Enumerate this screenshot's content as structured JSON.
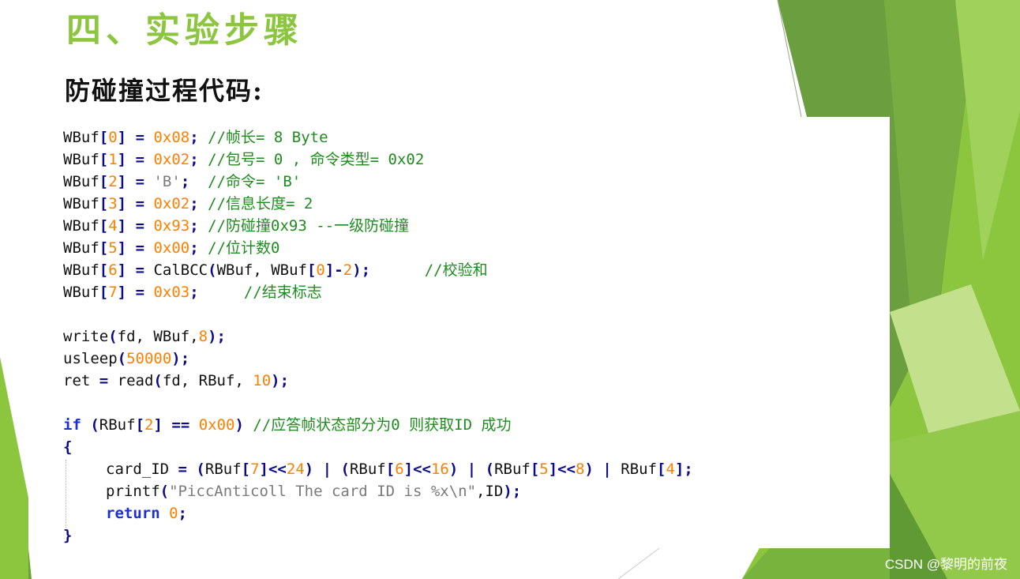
{
  "slide": {
    "title": "四、实验步骤",
    "subtitle": "防碰撞过程代码:",
    "watermark": "CSDN @黎明的前夜"
  },
  "theme": {
    "accent_green": "#8cc63e",
    "dark_green": "#5d9a36",
    "comment_green": "#1e8c1e",
    "number_orange": "#ff8000",
    "keyword_blue": "#1a2fd6",
    "operator_navy": "#0b0b8a"
  },
  "code": {
    "lines": [
      {
        "tokens": [
          {
            "t": "WBuf",
            "k": "id"
          },
          {
            "t": "[",
            "k": "op"
          },
          {
            "t": "0",
            "k": "num"
          },
          {
            "t": "]",
            "k": "op"
          },
          {
            "t": " ",
            "k": "id"
          },
          {
            "t": "=",
            "k": "op"
          },
          {
            "t": " ",
            "k": "id"
          },
          {
            "t": "0x08",
            "k": "num"
          },
          {
            "t": "; ",
            "k": "op"
          },
          {
            "t": "//帧长= 8 Byte",
            "k": "cm"
          }
        ]
      },
      {
        "tokens": [
          {
            "t": "WBuf",
            "k": "id"
          },
          {
            "t": "[",
            "k": "op"
          },
          {
            "t": "1",
            "k": "num"
          },
          {
            "t": "]",
            "k": "op"
          },
          {
            "t": " ",
            "k": "id"
          },
          {
            "t": "=",
            "k": "op"
          },
          {
            "t": " ",
            "k": "id"
          },
          {
            "t": "0x02",
            "k": "num"
          },
          {
            "t": "; ",
            "k": "op"
          },
          {
            "t": "//包号= 0 , 命令类型= 0x02",
            "k": "cm"
          }
        ]
      },
      {
        "tokens": [
          {
            "t": "WBuf",
            "k": "id"
          },
          {
            "t": "[",
            "k": "op"
          },
          {
            "t": "2",
            "k": "num"
          },
          {
            "t": "]",
            "k": "op"
          },
          {
            "t": " ",
            "k": "id"
          },
          {
            "t": "=",
            "k": "op"
          },
          {
            "t": " ",
            "k": "id"
          },
          {
            "t": "'B'",
            "k": "str"
          },
          {
            "t": ";  ",
            "k": "op"
          },
          {
            "t": "//命令= 'B'",
            "k": "cm"
          }
        ]
      },
      {
        "tokens": [
          {
            "t": "WBuf",
            "k": "id"
          },
          {
            "t": "[",
            "k": "op"
          },
          {
            "t": "3",
            "k": "num"
          },
          {
            "t": "]",
            "k": "op"
          },
          {
            "t": " ",
            "k": "id"
          },
          {
            "t": "=",
            "k": "op"
          },
          {
            "t": " ",
            "k": "id"
          },
          {
            "t": "0x02",
            "k": "num"
          },
          {
            "t": "; ",
            "k": "op"
          },
          {
            "t": "//信息长度= 2",
            "k": "cm"
          }
        ]
      },
      {
        "tokens": [
          {
            "t": "WBuf",
            "k": "id"
          },
          {
            "t": "[",
            "k": "op"
          },
          {
            "t": "4",
            "k": "num"
          },
          {
            "t": "]",
            "k": "op"
          },
          {
            "t": " ",
            "k": "id"
          },
          {
            "t": "=",
            "k": "op"
          },
          {
            "t": " ",
            "k": "id"
          },
          {
            "t": "0x93",
            "k": "num"
          },
          {
            "t": "; ",
            "k": "op"
          },
          {
            "t": "//防碰撞0x93 --一级防碰撞",
            "k": "cm"
          }
        ]
      },
      {
        "tokens": [
          {
            "t": "WBuf",
            "k": "id"
          },
          {
            "t": "[",
            "k": "op"
          },
          {
            "t": "5",
            "k": "num"
          },
          {
            "t": "]",
            "k": "op"
          },
          {
            "t": " ",
            "k": "id"
          },
          {
            "t": "=",
            "k": "op"
          },
          {
            "t": " ",
            "k": "id"
          },
          {
            "t": "0x00",
            "k": "num"
          },
          {
            "t": "; ",
            "k": "op"
          },
          {
            "t": "//位计数0",
            "k": "cm"
          }
        ]
      },
      {
        "tokens": [
          {
            "t": "WBuf",
            "k": "id"
          },
          {
            "t": "[",
            "k": "op"
          },
          {
            "t": "6",
            "k": "num"
          },
          {
            "t": "]",
            "k": "op"
          },
          {
            "t": " ",
            "k": "id"
          },
          {
            "t": "=",
            "k": "op"
          },
          {
            "t": " CalBCC",
            "k": "id"
          },
          {
            "t": "(",
            "k": "op"
          },
          {
            "t": "WBuf, WBuf",
            "k": "id"
          },
          {
            "t": "[",
            "k": "op"
          },
          {
            "t": "0",
            "k": "num"
          },
          {
            "t": "]-",
            "k": "op"
          },
          {
            "t": "2",
            "k": "num"
          },
          {
            "t": ");      ",
            "k": "op"
          },
          {
            "t": "//校验和",
            "k": "cm"
          }
        ]
      },
      {
        "tokens": [
          {
            "t": "WBuf",
            "k": "id"
          },
          {
            "t": "[",
            "k": "op"
          },
          {
            "t": "7",
            "k": "num"
          },
          {
            "t": "]",
            "k": "op"
          },
          {
            "t": " ",
            "k": "id"
          },
          {
            "t": "=",
            "k": "op"
          },
          {
            "t": " ",
            "k": "id"
          },
          {
            "t": "0x03",
            "k": "num"
          },
          {
            "t": ";     ",
            "k": "op"
          },
          {
            "t": "//结束标志",
            "k": "cm"
          }
        ]
      },
      {
        "blank": true
      },
      {
        "tokens": [
          {
            "t": "write",
            "k": "id"
          },
          {
            "t": "(",
            "k": "op"
          },
          {
            "t": "fd, WBuf,",
            "k": "id"
          },
          {
            "t": "8",
            "k": "num"
          },
          {
            "t": ");",
            "k": "op"
          }
        ]
      },
      {
        "tokens": [
          {
            "t": "usleep",
            "k": "id"
          },
          {
            "t": "(",
            "k": "op"
          },
          {
            "t": "50000",
            "k": "num"
          },
          {
            "t": ");",
            "k": "op"
          }
        ]
      },
      {
        "tokens": [
          {
            "t": "ret ",
            "k": "id"
          },
          {
            "t": "=",
            "k": "op"
          },
          {
            "t": " read",
            "k": "id"
          },
          {
            "t": "(",
            "k": "op"
          },
          {
            "t": "fd, RBuf, ",
            "k": "id"
          },
          {
            "t": "10",
            "k": "num"
          },
          {
            "t": ");",
            "k": "op"
          }
        ]
      },
      {
        "blank": true
      },
      {
        "tokens": [
          {
            "t": "if",
            "k": "kw"
          },
          {
            "t": " ",
            "k": "id"
          },
          {
            "t": "(",
            "k": "op"
          },
          {
            "t": "RBuf",
            "k": "id"
          },
          {
            "t": "[",
            "k": "op"
          },
          {
            "t": "2",
            "k": "num"
          },
          {
            "t": "]",
            "k": "op"
          },
          {
            "t": " ",
            "k": "id"
          },
          {
            "t": "==",
            "k": "op"
          },
          {
            "t": " ",
            "k": "id"
          },
          {
            "t": "0x00",
            "k": "num"
          },
          {
            "t": ") ",
            "k": "op"
          },
          {
            "t": "//应答帧状态部分为0 则获取ID 成功",
            "k": "cm"
          }
        ]
      },
      {
        "tokens": [
          {
            "t": "{",
            "k": "op"
          }
        ]
      },
      {
        "indent": 1,
        "tokens": [
          {
            "t": "card_ID ",
            "k": "id"
          },
          {
            "t": "=",
            "k": "op"
          },
          {
            "t": " ",
            "k": "id"
          },
          {
            "t": "(",
            "k": "op"
          },
          {
            "t": "RBuf",
            "k": "id"
          },
          {
            "t": "[",
            "k": "op"
          },
          {
            "t": "7",
            "k": "num"
          },
          {
            "t": "]<<",
            "k": "op"
          },
          {
            "t": "24",
            "k": "num"
          },
          {
            "t": ") | (",
            "k": "op"
          },
          {
            "t": "RBuf",
            "k": "id"
          },
          {
            "t": "[",
            "k": "op"
          },
          {
            "t": "6",
            "k": "num"
          },
          {
            "t": "]<<",
            "k": "op"
          },
          {
            "t": "16",
            "k": "num"
          },
          {
            "t": ") | (",
            "k": "op"
          },
          {
            "t": "RBuf",
            "k": "id"
          },
          {
            "t": "[",
            "k": "op"
          },
          {
            "t": "5",
            "k": "num"
          },
          {
            "t": "]<<",
            "k": "op"
          },
          {
            "t": "8",
            "k": "num"
          },
          {
            "t": ") | ",
            "k": "op"
          },
          {
            "t": "RBuf",
            "k": "id"
          },
          {
            "t": "[",
            "k": "op"
          },
          {
            "t": "4",
            "k": "num"
          },
          {
            "t": "];",
            "k": "op"
          }
        ]
      },
      {
        "indent": 1,
        "tokens": [
          {
            "t": "printf",
            "k": "id"
          },
          {
            "t": "(",
            "k": "op"
          },
          {
            "t": "\"PiccAnticoll The card ID is %x\\n\"",
            "k": "str"
          },
          {
            "t": ",ID",
            "k": "id"
          },
          {
            "t": ");",
            "k": "op"
          }
        ]
      },
      {
        "indent": 1,
        "tokens": [
          {
            "t": "return",
            "k": "kw"
          },
          {
            "t": " ",
            "k": "id"
          },
          {
            "t": "0",
            "k": "num"
          },
          {
            "t": ";",
            "k": "op"
          }
        ]
      },
      {
        "tokens": [
          {
            "t": "}",
            "k": "op"
          }
        ]
      }
    ]
  }
}
